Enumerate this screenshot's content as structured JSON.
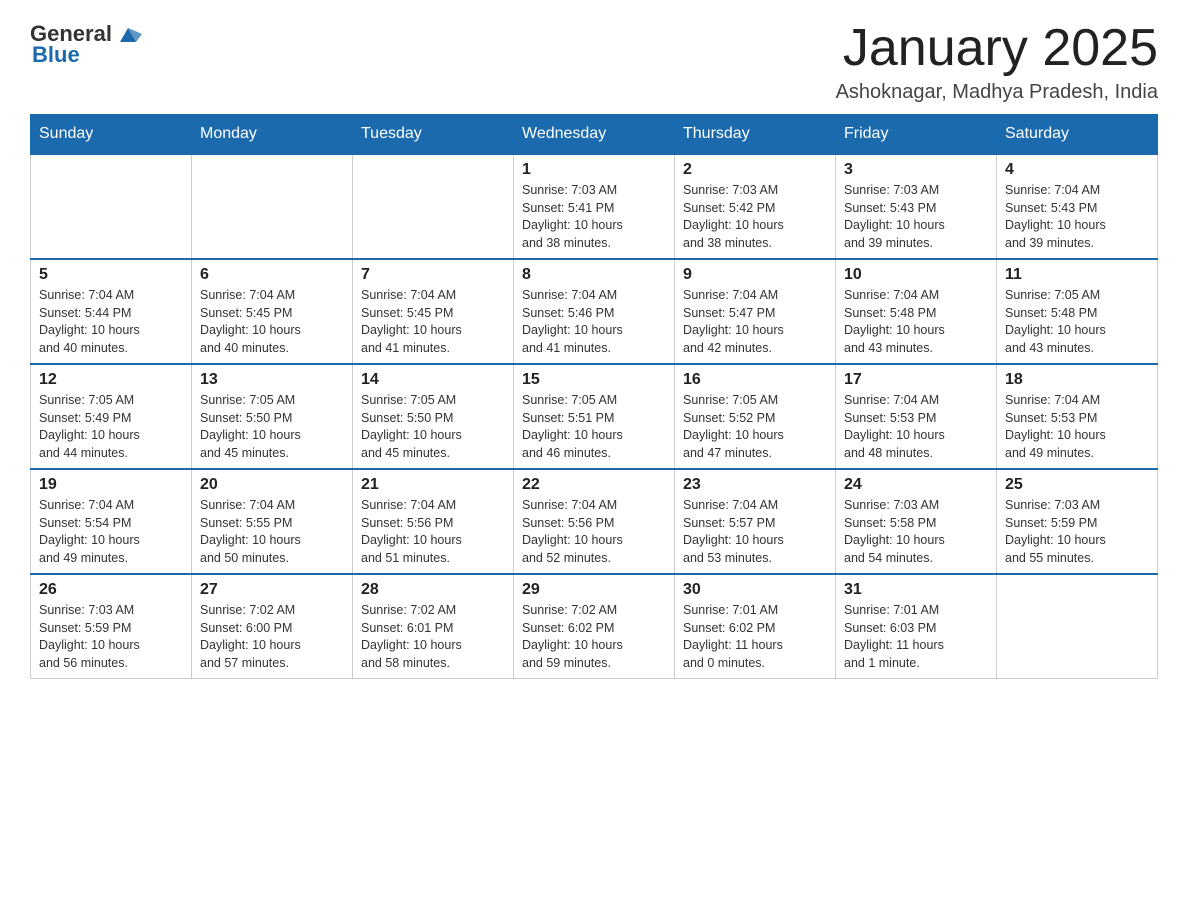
{
  "header": {
    "logo_general": "General",
    "logo_blue": "Blue",
    "month_title": "January 2025",
    "location": "Ashoknagar, Madhya Pradesh, India"
  },
  "days_of_week": [
    "Sunday",
    "Monday",
    "Tuesday",
    "Wednesday",
    "Thursday",
    "Friday",
    "Saturday"
  ],
  "weeks": [
    [
      {
        "day": "",
        "info": ""
      },
      {
        "day": "",
        "info": ""
      },
      {
        "day": "",
        "info": ""
      },
      {
        "day": "1",
        "info": "Sunrise: 7:03 AM\nSunset: 5:41 PM\nDaylight: 10 hours\nand 38 minutes."
      },
      {
        "day": "2",
        "info": "Sunrise: 7:03 AM\nSunset: 5:42 PM\nDaylight: 10 hours\nand 38 minutes."
      },
      {
        "day": "3",
        "info": "Sunrise: 7:03 AM\nSunset: 5:43 PM\nDaylight: 10 hours\nand 39 minutes."
      },
      {
        "day": "4",
        "info": "Sunrise: 7:04 AM\nSunset: 5:43 PM\nDaylight: 10 hours\nand 39 minutes."
      }
    ],
    [
      {
        "day": "5",
        "info": "Sunrise: 7:04 AM\nSunset: 5:44 PM\nDaylight: 10 hours\nand 40 minutes."
      },
      {
        "day": "6",
        "info": "Sunrise: 7:04 AM\nSunset: 5:45 PM\nDaylight: 10 hours\nand 40 minutes."
      },
      {
        "day": "7",
        "info": "Sunrise: 7:04 AM\nSunset: 5:45 PM\nDaylight: 10 hours\nand 41 minutes."
      },
      {
        "day": "8",
        "info": "Sunrise: 7:04 AM\nSunset: 5:46 PM\nDaylight: 10 hours\nand 41 minutes."
      },
      {
        "day": "9",
        "info": "Sunrise: 7:04 AM\nSunset: 5:47 PM\nDaylight: 10 hours\nand 42 minutes."
      },
      {
        "day": "10",
        "info": "Sunrise: 7:04 AM\nSunset: 5:48 PM\nDaylight: 10 hours\nand 43 minutes."
      },
      {
        "day": "11",
        "info": "Sunrise: 7:05 AM\nSunset: 5:48 PM\nDaylight: 10 hours\nand 43 minutes."
      }
    ],
    [
      {
        "day": "12",
        "info": "Sunrise: 7:05 AM\nSunset: 5:49 PM\nDaylight: 10 hours\nand 44 minutes."
      },
      {
        "day": "13",
        "info": "Sunrise: 7:05 AM\nSunset: 5:50 PM\nDaylight: 10 hours\nand 45 minutes."
      },
      {
        "day": "14",
        "info": "Sunrise: 7:05 AM\nSunset: 5:50 PM\nDaylight: 10 hours\nand 45 minutes."
      },
      {
        "day": "15",
        "info": "Sunrise: 7:05 AM\nSunset: 5:51 PM\nDaylight: 10 hours\nand 46 minutes."
      },
      {
        "day": "16",
        "info": "Sunrise: 7:05 AM\nSunset: 5:52 PM\nDaylight: 10 hours\nand 47 minutes."
      },
      {
        "day": "17",
        "info": "Sunrise: 7:04 AM\nSunset: 5:53 PM\nDaylight: 10 hours\nand 48 minutes."
      },
      {
        "day": "18",
        "info": "Sunrise: 7:04 AM\nSunset: 5:53 PM\nDaylight: 10 hours\nand 49 minutes."
      }
    ],
    [
      {
        "day": "19",
        "info": "Sunrise: 7:04 AM\nSunset: 5:54 PM\nDaylight: 10 hours\nand 49 minutes."
      },
      {
        "day": "20",
        "info": "Sunrise: 7:04 AM\nSunset: 5:55 PM\nDaylight: 10 hours\nand 50 minutes."
      },
      {
        "day": "21",
        "info": "Sunrise: 7:04 AM\nSunset: 5:56 PM\nDaylight: 10 hours\nand 51 minutes."
      },
      {
        "day": "22",
        "info": "Sunrise: 7:04 AM\nSunset: 5:56 PM\nDaylight: 10 hours\nand 52 minutes."
      },
      {
        "day": "23",
        "info": "Sunrise: 7:04 AM\nSunset: 5:57 PM\nDaylight: 10 hours\nand 53 minutes."
      },
      {
        "day": "24",
        "info": "Sunrise: 7:03 AM\nSunset: 5:58 PM\nDaylight: 10 hours\nand 54 minutes."
      },
      {
        "day": "25",
        "info": "Sunrise: 7:03 AM\nSunset: 5:59 PM\nDaylight: 10 hours\nand 55 minutes."
      }
    ],
    [
      {
        "day": "26",
        "info": "Sunrise: 7:03 AM\nSunset: 5:59 PM\nDaylight: 10 hours\nand 56 minutes."
      },
      {
        "day": "27",
        "info": "Sunrise: 7:02 AM\nSunset: 6:00 PM\nDaylight: 10 hours\nand 57 minutes."
      },
      {
        "day": "28",
        "info": "Sunrise: 7:02 AM\nSunset: 6:01 PM\nDaylight: 10 hours\nand 58 minutes."
      },
      {
        "day": "29",
        "info": "Sunrise: 7:02 AM\nSunset: 6:02 PM\nDaylight: 10 hours\nand 59 minutes."
      },
      {
        "day": "30",
        "info": "Sunrise: 7:01 AM\nSunset: 6:02 PM\nDaylight: 11 hours\nand 0 minutes."
      },
      {
        "day": "31",
        "info": "Sunrise: 7:01 AM\nSunset: 6:03 PM\nDaylight: 11 hours\nand 1 minute."
      },
      {
        "day": "",
        "info": ""
      }
    ]
  ]
}
